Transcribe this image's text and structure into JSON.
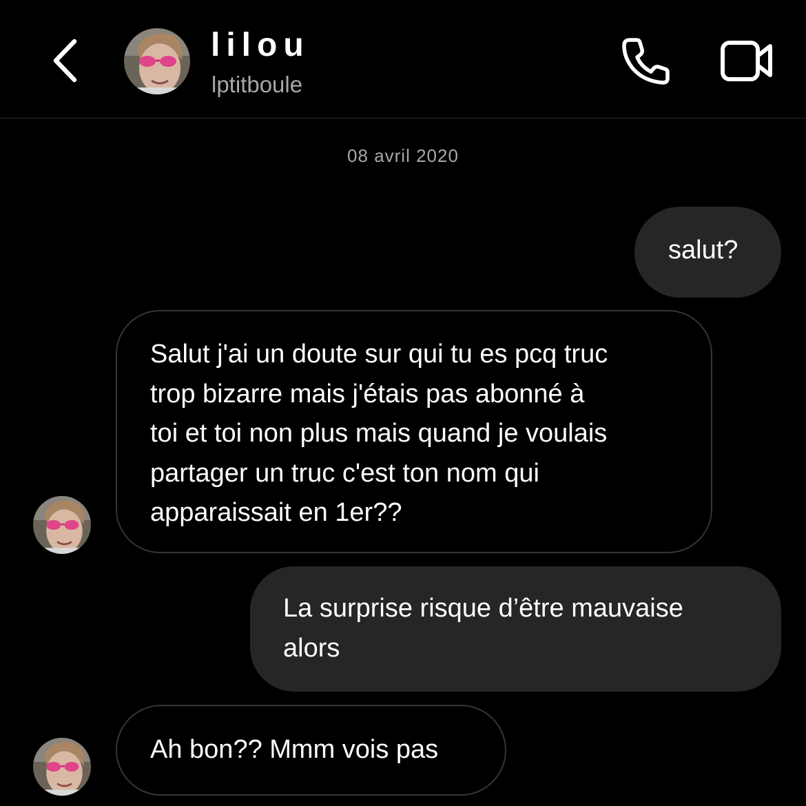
{
  "header": {
    "name": "lilou",
    "username": "lptitboule",
    "icons": {
      "back": "chevron-left-icon",
      "call": "phone-icon",
      "video": "video-camera-icon"
    }
  },
  "thread": {
    "date_separator": "08 avril 2020",
    "messages": [
      {
        "direction": "outgoing",
        "lines": [
          "salut?"
        ]
      },
      {
        "direction": "incoming",
        "lines": [
          "Salut j'ai un doute sur qui tu es pcq truc",
          "trop bizarre mais j'étais pas abonné à",
          "toi et toi non plus mais quand je voulais",
          "partager un truc c'est ton nom qui",
          "apparaissait en 1er??"
        ]
      },
      {
        "direction": "outgoing",
        "lines": [
          "La surprise risque d’être mauvaise",
          "alors"
        ]
      },
      {
        "direction": "incoming",
        "lines": [
          "Ah bon?? Mmm vois pas"
        ]
      }
    ]
  },
  "colors": {
    "background": "#000000",
    "outgoing_bubble": "#262626",
    "incoming_border": "#363636",
    "secondary_text": "#a8a8a8"
  }
}
